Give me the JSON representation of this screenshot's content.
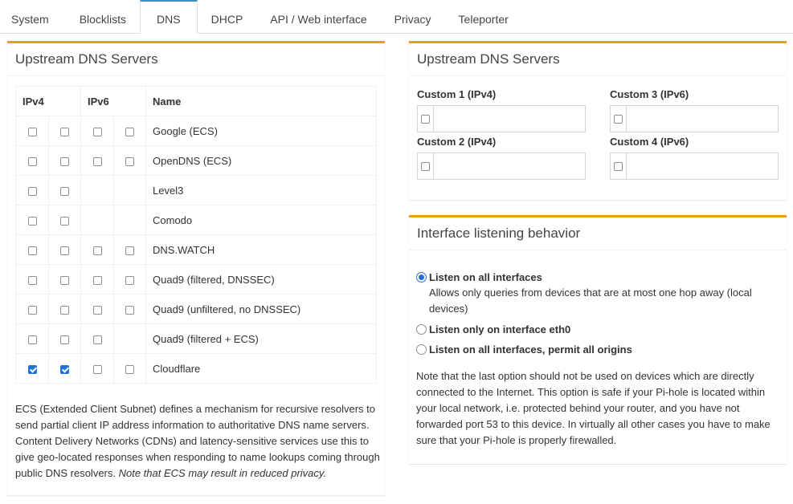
{
  "tabs": [
    {
      "label": "System",
      "active": false
    },
    {
      "label": "Blocklists",
      "active": false
    },
    {
      "label": "DNS",
      "active": true
    },
    {
      "label": "DHCP",
      "active": false
    },
    {
      "label": "API / Web interface",
      "active": false
    },
    {
      "label": "Privacy",
      "active": false
    },
    {
      "label": "Teleporter",
      "active": false
    }
  ],
  "upstream": {
    "title": "Upstream DNS Servers",
    "headers": {
      "ipv4": "IPv4",
      "ipv6": "IPv6",
      "name": "Name"
    },
    "servers": [
      {
        "name": "Google (ECS)",
        "v4": [
          false,
          false
        ],
        "v6": [
          false,
          false
        ]
      },
      {
        "name": "OpenDNS (ECS)",
        "v4": [
          false,
          false
        ],
        "v6": [
          false,
          false
        ]
      },
      {
        "name": "Level3",
        "v4": [
          false,
          false
        ],
        "v6": null
      },
      {
        "name": "Comodo",
        "v4": [
          false,
          false
        ],
        "v6": null
      },
      {
        "name": "DNS.WATCH",
        "v4": [
          false,
          false
        ],
        "v6": [
          false,
          false
        ]
      },
      {
        "name": "Quad9 (filtered, DNSSEC)",
        "v4": [
          false,
          false
        ],
        "v6": [
          false,
          false
        ]
      },
      {
        "name": "Quad9 (unfiltered, no DNSSEC)",
        "v4": [
          false,
          false
        ],
        "v6": [
          false,
          false
        ]
      },
      {
        "name": "Quad9 (filtered + ECS)",
        "v4": [
          false,
          false
        ],
        "v6": [
          false
        ]
      },
      {
        "name": "Cloudflare",
        "v4": [
          true,
          true
        ],
        "v6": [
          false,
          false
        ]
      }
    ],
    "ecs_note": "ECS (Extended Client Subnet) defines a mechanism for recursive resolvers to send partial client IP address information to authoritative DNS name servers. Content Delivery Networks (CDNs) and latency-sensitive services use this to give geo-located responses when responding to name lookups coming through public DNS resolvers. ",
    "ecs_note_em": "Note that ECS may result in reduced privacy."
  },
  "custom": {
    "title": "Upstream DNS Servers",
    "c1": {
      "label": "Custom 1 (IPv4)",
      "value": "",
      "checked": false
    },
    "c2": {
      "label": "Custom 2 (IPv4)",
      "value": "",
      "checked": false
    },
    "c3": {
      "label": "Custom 3 (IPv6)",
      "value": "",
      "checked": false
    },
    "c4": {
      "label": "Custom 4 (IPv6)",
      "value": "",
      "checked": false
    }
  },
  "iface": {
    "title": "Interface listening behavior",
    "options": [
      {
        "label": "Listen on all interfaces",
        "desc": "Allows only queries from devices that are at most one hop away (local devices)",
        "selected": true
      },
      {
        "label": "Listen only on interface eth0",
        "desc": "",
        "selected": false
      },
      {
        "label": "Listen on all interfaces, permit all origins",
        "desc": "",
        "selected": false
      }
    ],
    "note": "Note that the last option should not be used on devices which are directly connected to the Internet. This option is safe if your Pi-hole is located within your local network, i.e. protected behind your router, and you have not forwarded port 53 to this device. In virtually all other cases you have to make sure that your Pi-hole is properly firewalled."
  },
  "colors": {
    "accent_tab": "#3c8dbc",
    "box_border": "#f39c12",
    "check": "#2370d8"
  }
}
